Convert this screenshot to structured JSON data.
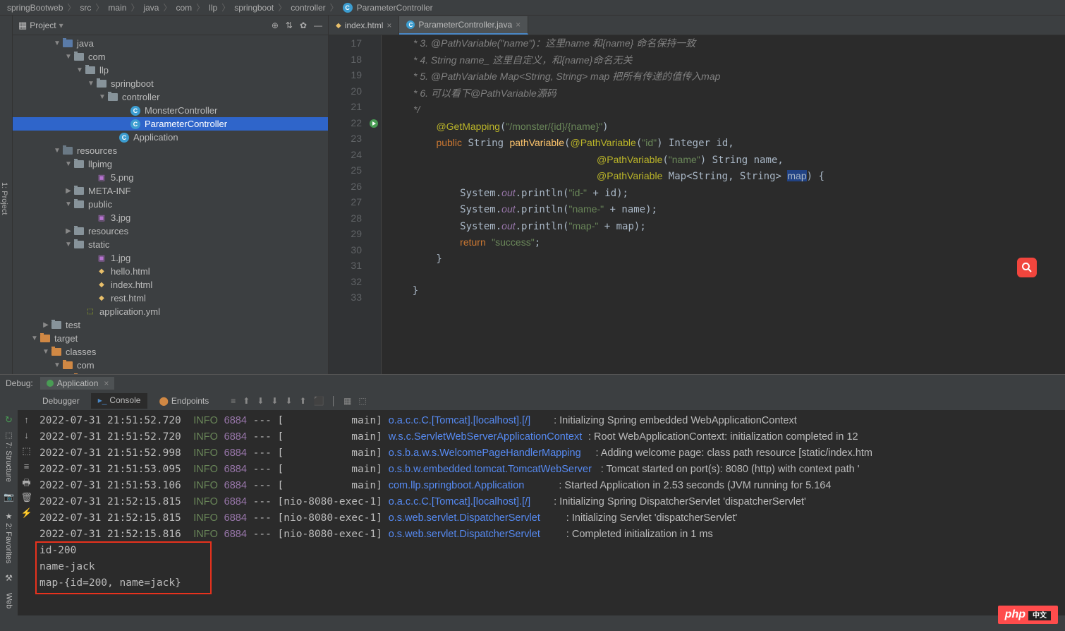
{
  "breadcrumb": [
    "springBootweb",
    "src",
    "main",
    "java",
    "com",
    "llp",
    "springboot",
    "controller",
    "ParameterController"
  ],
  "sidebarLeft": "1: Project",
  "projectTitle": "Project",
  "tree": [
    {
      "depth": 3,
      "arrow": "▼",
      "iconType": "blue-folder",
      "label": "java"
    },
    {
      "depth": 4,
      "arrow": "▼",
      "iconType": "gray-folder",
      "label": "com"
    },
    {
      "depth": 5,
      "arrow": "▼",
      "iconType": "gray-folder",
      "label": "llp"
    },
    {
      "depth": 6,
      "arrow": "▼",
      "iconType": "gray-folder",
      "label": "springboot"
    },
    {
      "depth": 7,
      "arrow": "▼",
      "iconType": "gray-folder",
      "label": "controller"
    },
    {
      "depth": 9,
      "arrow": "",
      "iconType": "cls",
      "label": "MonsterController"
    },
    {
      "depth": 9,
      "arrow": "",
      "iconType": "cls",
      "label": "ParameterController",
      "selected": true
    },
    {
      "depth": 8,
      "arrow": "",
      "iconType": "cls-run",
      "label": "Application"
    },
    {
      "depth": 3,
      "arrow": "▼",
      "iconType": "dark-folder",
      "label": "resources"
    },
    {
      "depth": 4,
      "arrow": "▼",
      "iconType": "gray-folder",
      "label": "llpimg"
    },
    {
      "depth": 6,
      "arrow": "",
      "iconType": "img",
      "label": "5.png"
    },
    {
      "depth": 4,
      "arrow": "▶",
      "iconType": "gray-folder",
      "label": "META-INF"
    },
    {
      "depth": 4,
      "arrow": "▼",
      "iconType": "gray-folder",
      "label": "public"
    },
    {
      "depth": 6,
      "arrow": "",
      "iconType": "img",
      "label": "3.jpg"
    },
    {
      "depth": 4,
      "arrow": "▶",
      "iconType": "gray-folder",
      "label": "resources"
    },
    {
      "depth": 4,
      "arrow": "▼",
      "iconType": "gray-folder",
      "label": "static"
    },
    {
      "depth": 6,
      "arrow": "",
      "iconType": "img",
      "label": "1.jpg"
    },
    {
      "depth": 6,
      "arrow": "",
      "iconType": "html",
      "label": "hello.html"
    },
    {
      "depth": 6,
      "arrow": "",
      "iconType": "html",
      "label": "index.html"
    },
    {
      "depth": 6,
      "arrow": "",
      "iconType": "html",
      "label": "rest.html"
    },
    {
      "depth": 5,
      "arrow": "",
      "iconType": "yml",
      "label": "application.yml"
    },
    {
      "depth": 2,
      "arrow": "▶",
      "iconType": "gray-folder",
      "label": "test"
    },
    {
      "depth": 1,
      "arrow": "▼",
      "iconType": "orange-folder",
      "label": "target"
    },
    {
      "depth": 2,
      "arrow": "▼",
      "iconType": "orange-folder",
      "label": "classes"
    },
    {
      "depth": 3,
      "arrow": "▼",
      "iconType": "orange-folder",
      "label": "com"
    },
    {
      "depth": 4,
      "arrow": "▶",
      "iconType": "orange-folder",
      "label": "llp"
    }
  ],
  "tabs": [
    {
      "icon": "html",
      "label": "index.html",
      "active": false
    },
    {
      "icon": "cls",
      "label": "ParameterController.java",
      "active": true
    }
  ],
  "lineStart": 17,
  "lineEnd": 33,
  "code": [
    {
      "t": "comment",
      "txt": "         * 3. @PathVariable(\"name\") : 这里name 和{name} 命名保持一致"
    },
    {
      "t": "comment",
      "txt": "         * 4. String name_ 这里自定义，和{name}命名无关"
    },
    {
      "t": "comment",
      "txt": "         * 5. @PathVariable Map<String, String> map 把所有传递的值传入map"
    },
    {
      "t": "comment",
      "txt": "         * 6. 可以看下@PathVariable源码"
    },
    {
      "t": "comment",
      "txt": "         */"
    },
    {
      "t": "code",
      "txt": "GetMapping_line"
    },
    {
      "t": "code",
      "txt": "public_line"
    },
    {
      "t": "code",
      "txt": "param_name_line"
    },
    {
      "t": "code",
      "txt": "param_map_line"
    },
    {
      "t": "code",
      "txt": "print_id_line"
    },
    {
      "t": "code",
      "txt": "print_name_line"
    },
    {
      "t": "code",
      "txt": "print_map_line"
    },
    {
      "t": "code",
      "txt": "return_line"
    },
    {
      "t": "code",
      "txt": "brace1"
    },
    {
      "t": "code",
      "txt": "blank"
    },
    {
      "t": "code",
      "txt": "brace2"
    },
    {
      "t": "code",
      "txt": "blank"
    }
  ],
  "debugTitle": "Debug:",
  "debugApp": "Application",
  "debugTabs": [
    "Debugger",
    "Console",
    "Endpoints"
  ],
  "debugTabActive": 1,
  "consoleLines": [
    {
      "ts": "2022-07-31 21:51:52.720",
      "lvl": "INFO",
      "pid": "6884",
      "thread": "[           main]",
      "logger": "o.a.c.c.C.[Tomcat].[localhost].[/]      ",
      "msg": ": Initializing Spring embedded WebApplicationContext"
    },
    {
      "ts": "2022-07-31 21:51:52.720",
      "lvl": "INFO",
      "pid": "6884",
      "thread": "[           main]",
      "logger": "w.s.c.ServletWebServerApplicationContext",
      "msg": ": Root WebApplicationContext: initialization completed in 12"
    },
    {
      "ts": "2022-07-31 21:51:52.998",
      "lvl": "INFO",
      "pid": "6884",
      "thread": "[           main]",
      "logger": "o.s.b.a.w.s.WelcomePageHandlerMapping   ",
      "msg": ": Adding welcome page: class path resource [static/index.htm"
    },
    {
      "ts": "2022-07-31 21:51:53.095",
      "lvl": "INFO",
      "pid": "6884",
      "thread": "[           main]",
      "logger": "o.s.b.w.embedded.tomcat.TomcatWebServer ",
      "msg": ": Tomcat started on port(s): 8080 (http) with context path '"
    },
    {
      "ts": "2022-07-31 21:51:53.106",
      "lvl": "INFO",
      "pid": "6884",
      "thread": "[           main]",
      "logger": "com.llp.springboot.Application          ",
      "msg": ": Started Application in 2.53 seconds (JVM running for 5.164"
    },
    {
      "ts": "2022-07-31 21:52:15.815",
      "lvl": "INFO",
      "pid": "6884",
      "thread": "[nio-8080-exec-1]",
      "logger": "o.a.c.c.C.[Tomcat].[localhost].[/]      ",
      "msg": ": Initializing Spring DispatcherServlet 'dispatcherServlet'"
    },
    {
      "ts": "2022-07-31 21:52:15.815",
      "lvl": "INFO",
      "pid": "6884",
      "thread": "[nio-8080-exec-1]",
      "logger": "o.s.web.servlet.DispatcherServlet       ",
      "msg": ": Initializing Servlet 'dispatcherServlet'"
    },
    {
      "ts": "2022-07-31 21:52:15.816",
      "lvl": "INFO",
      "pid": "6884",
      "thread": "[nio-8080-exec-1]",
      "logger": "o.s.web.servlet.DispatcherServlet       ",
      "msg": ": Completed initialization in 1 ms"
    }
  ],
  "consoleOutput": [
    "id-200",
    "name-jack",
    "map-{id=200, name=jack}"
  ],
  "phpBadge": "php",
  "phpCn": "中文"
}
